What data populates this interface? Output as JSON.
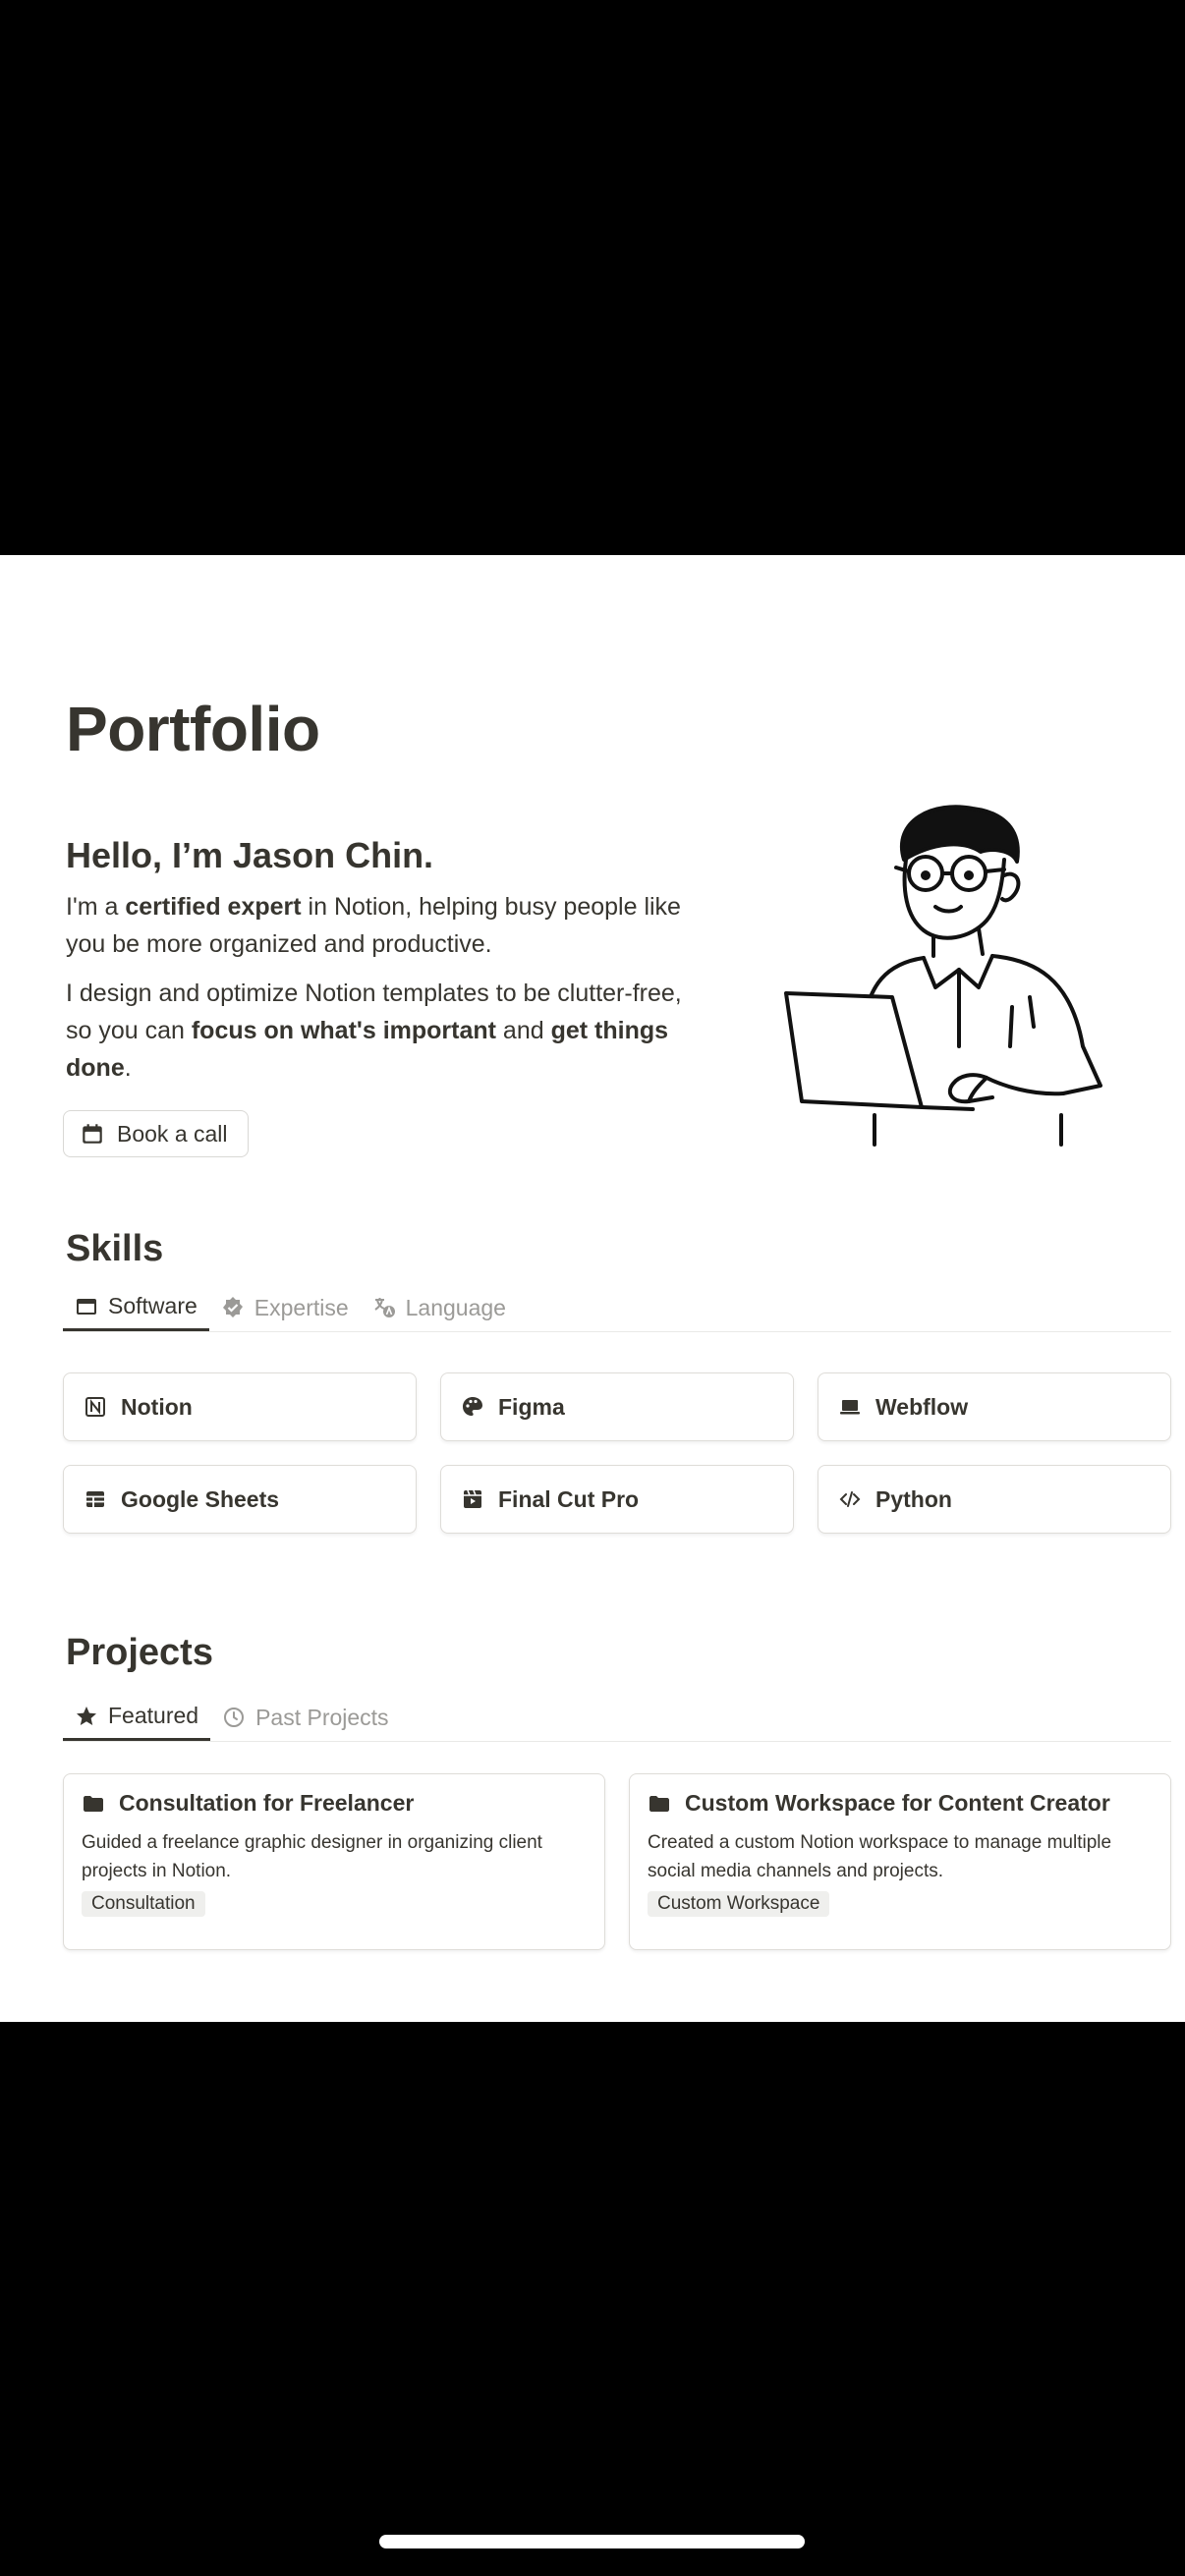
{
  "page": {
    "title": "Portfolio"
  },
  "hero": {
    "greeting": "Hello, I’m Jason Chin.",
    "p1": {
      "a": "I'm a ",
      "b": "certified expert",
      "c": " in Notion, helping busy people like you be more organized and productive."
    },
    "p2": {
      "a": "I design and optimize Notion templates to be clutter-free, so you can ",
      "b": "focus on what's important",
      "c": " and ",
      "d": "get things done",
      "e": "."
    },
    "button_label": "Book a call"
  },
  "skills": {
    "title": "Skills",
    "tabs": [
      {
        "label": "Software",
        "icon": "browser-window-icon"
      },
      {
        "label": "Expertise",
        "icon": "verified-badge-icon"
      },
      {
        "label": "Language",
        "icon": "translate-icon"
      }
    ],
    "items": [
      {
        "label": "Notion",
        "icon": "notion-icon"
      },
      {
        "label": "Figma",
        "icon": "palette-icon"
      },
      {
        "label": "Webflow",
        "icon": "laptop-icon"
      },
      {
        "label": "Google Sheets",
        "icon": "table-icon"
      },
      {
        "label": "Final Cut Pro",
        "icon": "film-icon"
      },
      {
        "label": "Python",
        "icon": "code-icon"
      }
    ]
  },
  "projects": {
    "title": "Projects",
    "tabs": [
      {
        "label": "Featured",
        "icon": "star-icon"
      },
      {
        "label": "Past Projects",
        "icon": "clock-icon"
      }
    ],
    "cards": [
      {
        "title": "Consultation for Freelancer",
        "description": "Guided a freelance graphic designer in organizing client projects in Notion.",
        "tag": "Consultation",
        "icon": "folder-icon"
      },
      {
        "title": "Custom Workspace for Content Creator",
        "description": "Created a custom Notion workspace to manage multiple social media channels and projects.",
        "tag": "Custom Workspace",
        "icon": "folder-icon"
      }
    ]
  }
}
